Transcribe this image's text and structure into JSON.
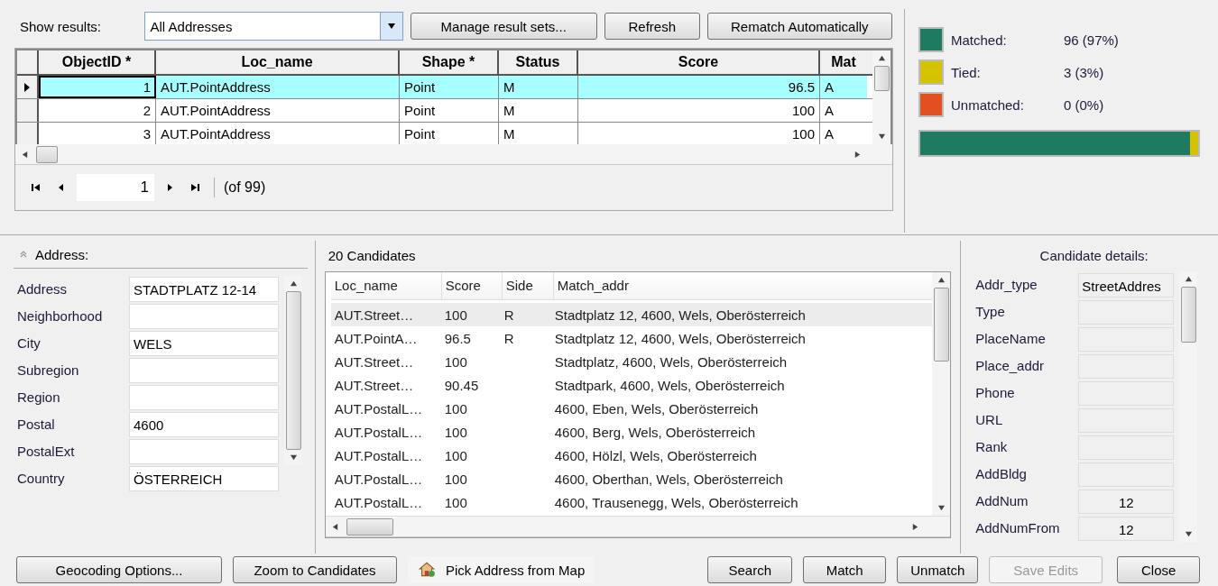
{
  "toolbar": {
    "label": "Show results:",
    "dropdown": "All Addresses",
    "buttons": [
      "Manage result sets...",
      "Refresh",
      "Rematch Automatically"
    ]
  },
  "results_table": {
    "columns": [
      "ObjectID *",
      "Loc_name",
      "Shape *",
      "Status",
      "Score",
      "Mat"
    ],
    "rows": [
      {
        "selected": true,
        "cells": [
          "1",
          "AUT.PointAddress",
          "Point",
          "M",
          "96.5",
          "A"
        ]
      },
      {
        "selected": false,
        "cells": [
          "2",
          "AUT.PointAddress",
          "Point",
          "M",
          "100",
          "A"
        ]
      },
      {
        "selected": false,
        "cells": [
          "3",
          "AUT.PointAddress",
          "Point",
          "M",
          "100",
          "A"
        ]
      }
    ],
    "pager": {
      "page": "1",
      "total": "(of 99)"
    }
  },
  "stats": {
    "items": [
      {
        "label": "Matched:",
        "value": "96 (97%)",
        "color": "#1e7b62"
      },
      {
        "label": "Tied:",
        "value": "3 (3%)",
        "color": "#d4c400"
      },
      {
        "label": "Unmatched:",
        "value": "0 (0%)",
        "color": "#e05020"
      }
    ],
    "bar": [
      {
        "level": 0.97,
        "color": "#1e7b62"
      },
      {
        "level": 0.03,
        "color": "#d4c400"
      }
    ]
  },
  "address": {
    "title": "Address:",
    "fields": [
      {
        "label": "Address",
        "value": "STADTPLATZ 12-14"
      },
      {
        "label": "Neighborhood"
      },
      {
        "label": "City",
        "value": "WELS"
      },
      {
        "label": "Subregion"
      },
      {
        "label": "Region"
      },
      {
        "label": "Postal",
        "value": "4600"
      },
      {
        "label": "PostalExt"
      },
      {
        "label": "Country",
        "value": "ÖSTERREICH"
      }
    ]
  },
  "candidates": {
    "title": "20 Candidates",
    "columns": [
      "Loc_name",
      "Score",
      "Side",
      "Match_addr"
    ],
    "rows": [
      {
        "selected": true,
        "cells": [
          "AUT.Street…",
          "100",
          "R",
          "Stadtplatz 12, 4600, Wels, Oberösterreich"
        ]
      },
      {
        "selected": false,
        "cells": [
          "AUT.PointA…",
          "96.5",
          "R",
          "Stadtplatz 12, 4600, Wels, Oberösterreich"
        ]
      },
      {
        "selected": false,
        "cells": [
          "AUT.Street…",
          "100",
          "",
          "Stadtplatz, 4600, Wels, Oberösterreich"
        ]
      },
      {
        "selected": false,
        "cells": [
          "AUT.Street…",
          "90.45",
          "",
          "Stadtpark, 4600, Wels, Oberösterreich"
        ]
      },
      {
        "selected": false,
        "cells": [
          "AUT.PostalL…",
          "100",
          "",
          "4600, Eben, Wels, Oberösterreich"
        ]
      },
      {
        "selected": false,
        "cells": [
          "AUT.PostalL…",
          "100",
          "",
          "4600, Berg, Wels, Oberösterreich"
        ]
      },
      {
        "selected": false,
        "cells": [
          "AUT.PostalL…",
          "100",
          "",
          "4600, Hölzl, Wels, Oberösterreich"
        ]
      },
      {
        "selected": false,
        "cells": [
          "AUT.PostalL…",
          "100",
          "",
          "4600, Oberthan, Wels, Oberösterreich"
        ]
      },
      {
        "selected": false,
        "cells": [
          "AUT.PostalL…",
          "100",
          "",
          "4600, Trausenegg, Wels, Oberösterreich"
        ]
      }
    ]
  },
  "details": {
    "title": "Candidate details:",
    "fields": [
      {
        "label": "Addr_type",
        "value": "StreetAddres",
        "kind": "text"
      },
      {
        "label": "Type",
        "kind": "text"
      },
      {
        "label": "PlaceName",
        "kind": "text"
      },
      {
        "label": "Place_addr",
        "kind": "text"
      },
      {
        "label": "Phone",
        "kind": "text"
      },
      {
        "label": "URL",
        "kind": "text"
      },
      {
        "label": "Rank",
        "kind": "text"
      },
      {
        "label": "AddBldg",
        "kind": "text"
      },
      {
        "label": "AddNum",
        "value": "12",
        "kind": "number"
      },
      {
        "label": "AddNumFrom",
        "value": "12",
        "kind": "number"
      }
    ]
  },
  "bottom_buttons": [
    {
      "label": "Geocoding Options...",
      "kind": "button",
      "disabled": false
    },
    {
      "label": "Zoom to Candidates",
      "kind": "button",
      "disabled": false
    },
    {
      "label": "Pick Address from Map",
      "kind": "tool",
      "disabled": false
    },
    {
      "label": "Search",
      "kind": "button",
      "disabled": false
    },
    {
      "label": "Match",
      "kind": "button",
      "disabled": false
    },
    {
      "label": "Unmatch",
      "kind": "button",
      "disabled": false
    },
    {
      "label": "Save Edits",
      "kind": "button",
      "disabled": true
    },
    {
      "label": "Close",
      "kind": "button",
      "disabled": false
    }
  ]
}
